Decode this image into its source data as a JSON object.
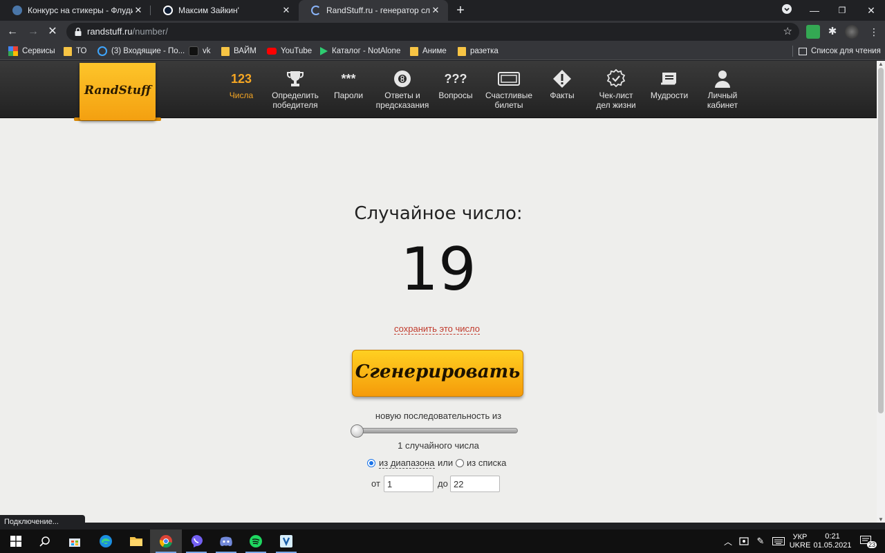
{
  "browser": {
    "tabs": [
      {
        "title": "Конкурс на стикеры - Флудильня",
        "active": false
      },
      {
        "title": "Максим Зайкин'",
        "active": false
      },
      {
        "title": "RandStuff.ru - генератор случайн",
        "active": true
      }
    ],
    "new_tab_label": "+",
    "url_host": "randstuff.ru",
    "url_path": "/number/",
    "bookmarks": [
      {
        "label": "Сервисы",
        "icon": "apps-grid-icon"
      },
      {
        "label": "ТО",
        "icon": "folder-icon"
      },
      {
        "label": "(3) Входящие - По...",
        "icon": "mail-icon"
      },
      {
        "label": "vk",
        "icon": "vk-icon"
      },
      {
        "label": "ВАЙМ",
        "icon": "folder-icon"
      },
      {
        "label": "YouTube",
        "icon": "youtube-icon"
      },
      {
        "label": "Каталог - NotAlone",
        "icon": "play-triangle-icon"
      },
      {
        "label": "Аниме",
        "icon": "folder-icon"
      },
      {
        "label": "разетка",
        "icon": "folder-icon"
      }
    ],
    "reading_list": "Список для чтения",
    "status_text": "Подключение..."
  },
  "site": {
    "logo_text": "RandStuff",
    "nav": [
      {
        "label1": "Числа",
        "label2": "",
        "icon_text": "123",
        "icon": "numbers-icon",
        "active": true
      },
      {
        "label1": "Определить",
        "label2": "победителя",
        "icon_text": "",
        "icon": "trophy-icon",
        "active": false
      },
      {
        "label1": "Пароли",
        "label2": "",
        "icon_text": "***",
        "icon": "password-icon",
        "active": false
      },
      {
        "label1": "Ответы и",
        "label2": "предсказания",
        "icon_text": "",
        "icon": "magic-8-ball-icon",
        "active": false
      },
      {
        "label1": "Вопросы",
        "label2": "",
        "icon_text": "???",
        "icon": "questions-icon",
        "active": false
      },
      {
        "label1": "Счастливые",
        "label2": "билеты",
        "icon_text": "",
        "icon": "ticket-icon",
        "active": false
      },
      {
        "label1": "Факты",
        "label2": "",
        "icon_text": "",
        "icon": "warning-diamond-icon",
        "active": false
      },
      {
        "label1": "Чек-лист",
        "label2": "дел жизни",
        "icon_text": "",
        "icon": "checklist-badge-icon",
        "active": false
      },
      {
        "label1": "Мудрости",
        "label2": "",
        "icon_text": "",
        "icon": "scroll-icon",
        "active": false
      },
      {
        "label1": "Личный",
        "label2": "кабинет",
        "icon_text": "",
        "icon": "user-icon",
        "active": false
      }
    ],
    "result_title": "Случайное число:",
    "result_value": "19",
    "save_link": "сохранить это число",
    "generate_button": "Сгенерировать",
    "sequence_label": "новую последовательность из",
    "count_label": "1 случайного числа",
    "slider_fraction": 0.0,
    "mode_range": "из диапазона",
    "mode_or": "или",
    "mode_list": "из списка",
    "mode_selected": "range",
    "from_label": "от",
    "from_value": "1",
    "to_label": "до",
    "to_value": "22"
  },
  "taskbar": {
    "apps": [
      "windows-start-icon",
      "search-icon",
      "store-icon",
      "edge-icon",
      "file-explorer-icon",
      "chrome-icon",
      "viber-icon",
      "discord-icon",
      "spotify-icon",
      "vpn-shield-icon"
    ],
    "lang1": "УКР",
    "lang2": "UKRE",
    "time": "0:21",
    "date": "01.05.2021",
    "notifications": "23"
  },
  "colors": {
    "accent_orange": "#f5a623",
    "page_bg": "#eeeeec",
    "link_red": "#c0392b",
    "chrome_dark": "#202124"
  }
}
